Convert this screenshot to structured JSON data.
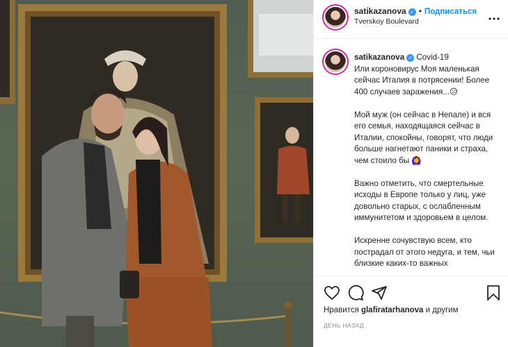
{
  "post": {
    "username": "satikazanova",
    "verified_icon": "verified-badge-icon",
    "follow_label": "Подписаться",
    "separator": "•",
    "location": "Tverskoy Boulevard",
    "more_icon": "more-options-icon"
  },
  "caption": {
    "username": "satikazanova",
    "lines": [
      "Covid-19",
      "Или коронovирус"
    ],
    "first_line": "Covid-19",
    "p1": "Или короновирус Моя маленькая сейчас Италия в потрясении! Более 400 случаев заражения...😥",
    "p2": "Мой муж (он сейчас в Непале) и вся его семья, находящаяся сейчас в Италии, спокойны, говорят, что люди больше нагнетают паники и страха, чем стоило бы 🙆‍♀️",
    "p3": "Важно отметить, что смертельные исходы в Европе только у лиц, уже довольно старых, с ослабленным иммунитетом и здоровьем в целом.",
    "p4": "Искренне сочувствую всем, кто пострадал от этого недуга, и тем, чьи близкие каких-то важных"
  },
  "actions": {
    "like_icon": "heart-icon",
    "comment_icon": "comment-icon",
    "share_icon": "share-icon",
    "save_icon": "bookmark-icon"
  },
  "likes": {
    "prefix": "Нравится ",
    "user": "glafiratarhanova",
    "suffix": " и другим"
  },
  "timestamp": "ДЕНЬ НАЗАД",
  "colors": {
    "accent": "#0095f6",
    "verified": "#3897f0",
    "wall": "#56634f"
  }
}
